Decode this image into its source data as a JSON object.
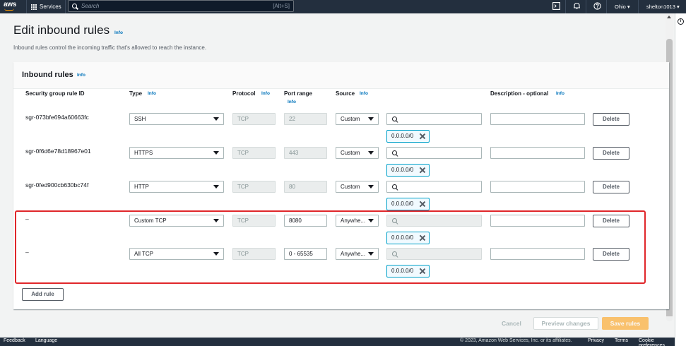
{
  "nav": {
    "logo": "aws",
    "services": "Services",
    "search_placeholder": "Search",
    "search_shortcut": "[Alt+S]",
    "region": "Ohio",
    "user": "shelton1013",
    "icons": [
      "cloudshell-icon",
      "bell-icon",
      "help-icon",
      "grid-icon",
      "search-icon"
    ]
  },
  "page": {
    "title": "Edit inbound rules",
    "title_info": "Info",
    "description": "Inbound rules control the incoming traffic that's allowed to reach the instance."
  },
  "section": {
    "title": "Inbound rules",
    "info": "Info",
    "columns": {
      "rule_id": "Security group rule ID",
      "type": "Type",
      "type_info": "Info",
      "protocol": "Protocol",
      "protocol_info": "Info",
      "port_range": "Port range",
      "port_info": "Info",
      "source": "Source",
      "source_info": "Info",
      "description": "Description - optional",
      "description_info": "Info"
    },
    "rules": [
      {
        "id": "sgr-073bfe694a60663fc",
        "type": "SSH",
        "protocol": "TCP",
        "port": "22",
        "source": "Custom",
        "cidr": "0.0.0.0/0",
        "delete": "Delete"
      },
      {
        "id": "sgr-0f6d6e78d18967e01",
        "type": "HTTPS",
        "protocol": "TCP",
        "port": "443",
        "source": "Custom",
        "cidr": "0.0.0.0/0",
        "delete": "Delete"
      },
      {
        "id": "sgr-0fed900cb630bc74f",
        "type": "HTTP",
        "protocol": "TCP",
        "port": "80",
        "source": "Custom",
        "cidr": "0.0.0.0/0",
        "delete": "Delete"
      },
      {
        "id": "–",
        "type": "Custom TCP",
        "protocol": "TCP",
        "port": "8080",
        "source": "Anywhe...",
        "cidr": "0.0.0.0/0",
        "delete": "Delete"
      },
      {
        "id": "–",
        "type": "All TCP",
        "protocol": "TCP",
        "port": "0 - 65535",
        "source": "Anywhe...",
        "cidr": "0.0.0.0/0",
        "delete": "Delete"
      }
    ],
    "add_rule": "Add rule"
  },
  "actions": {
    "cancel": "Cancel",
    "preview": "Preview changes",
    "save": "Save rules"
  },
  "footer": {
    "feedback": "Feedback",
    "language": "Language",
    "copyright": "© 2023, Amazon Web Services, Inc. or its affiliates.",
    "privacy": "Privacy",
    "terms": "Terms",
    "cookies": "Cookie preferences"
  },
  "colors": {
    "nav_bg": "#232f3e",
    "accent": "#ff9900",
    "link": "#0073bb",
    "highlight": "#e0262a"
  }
}
